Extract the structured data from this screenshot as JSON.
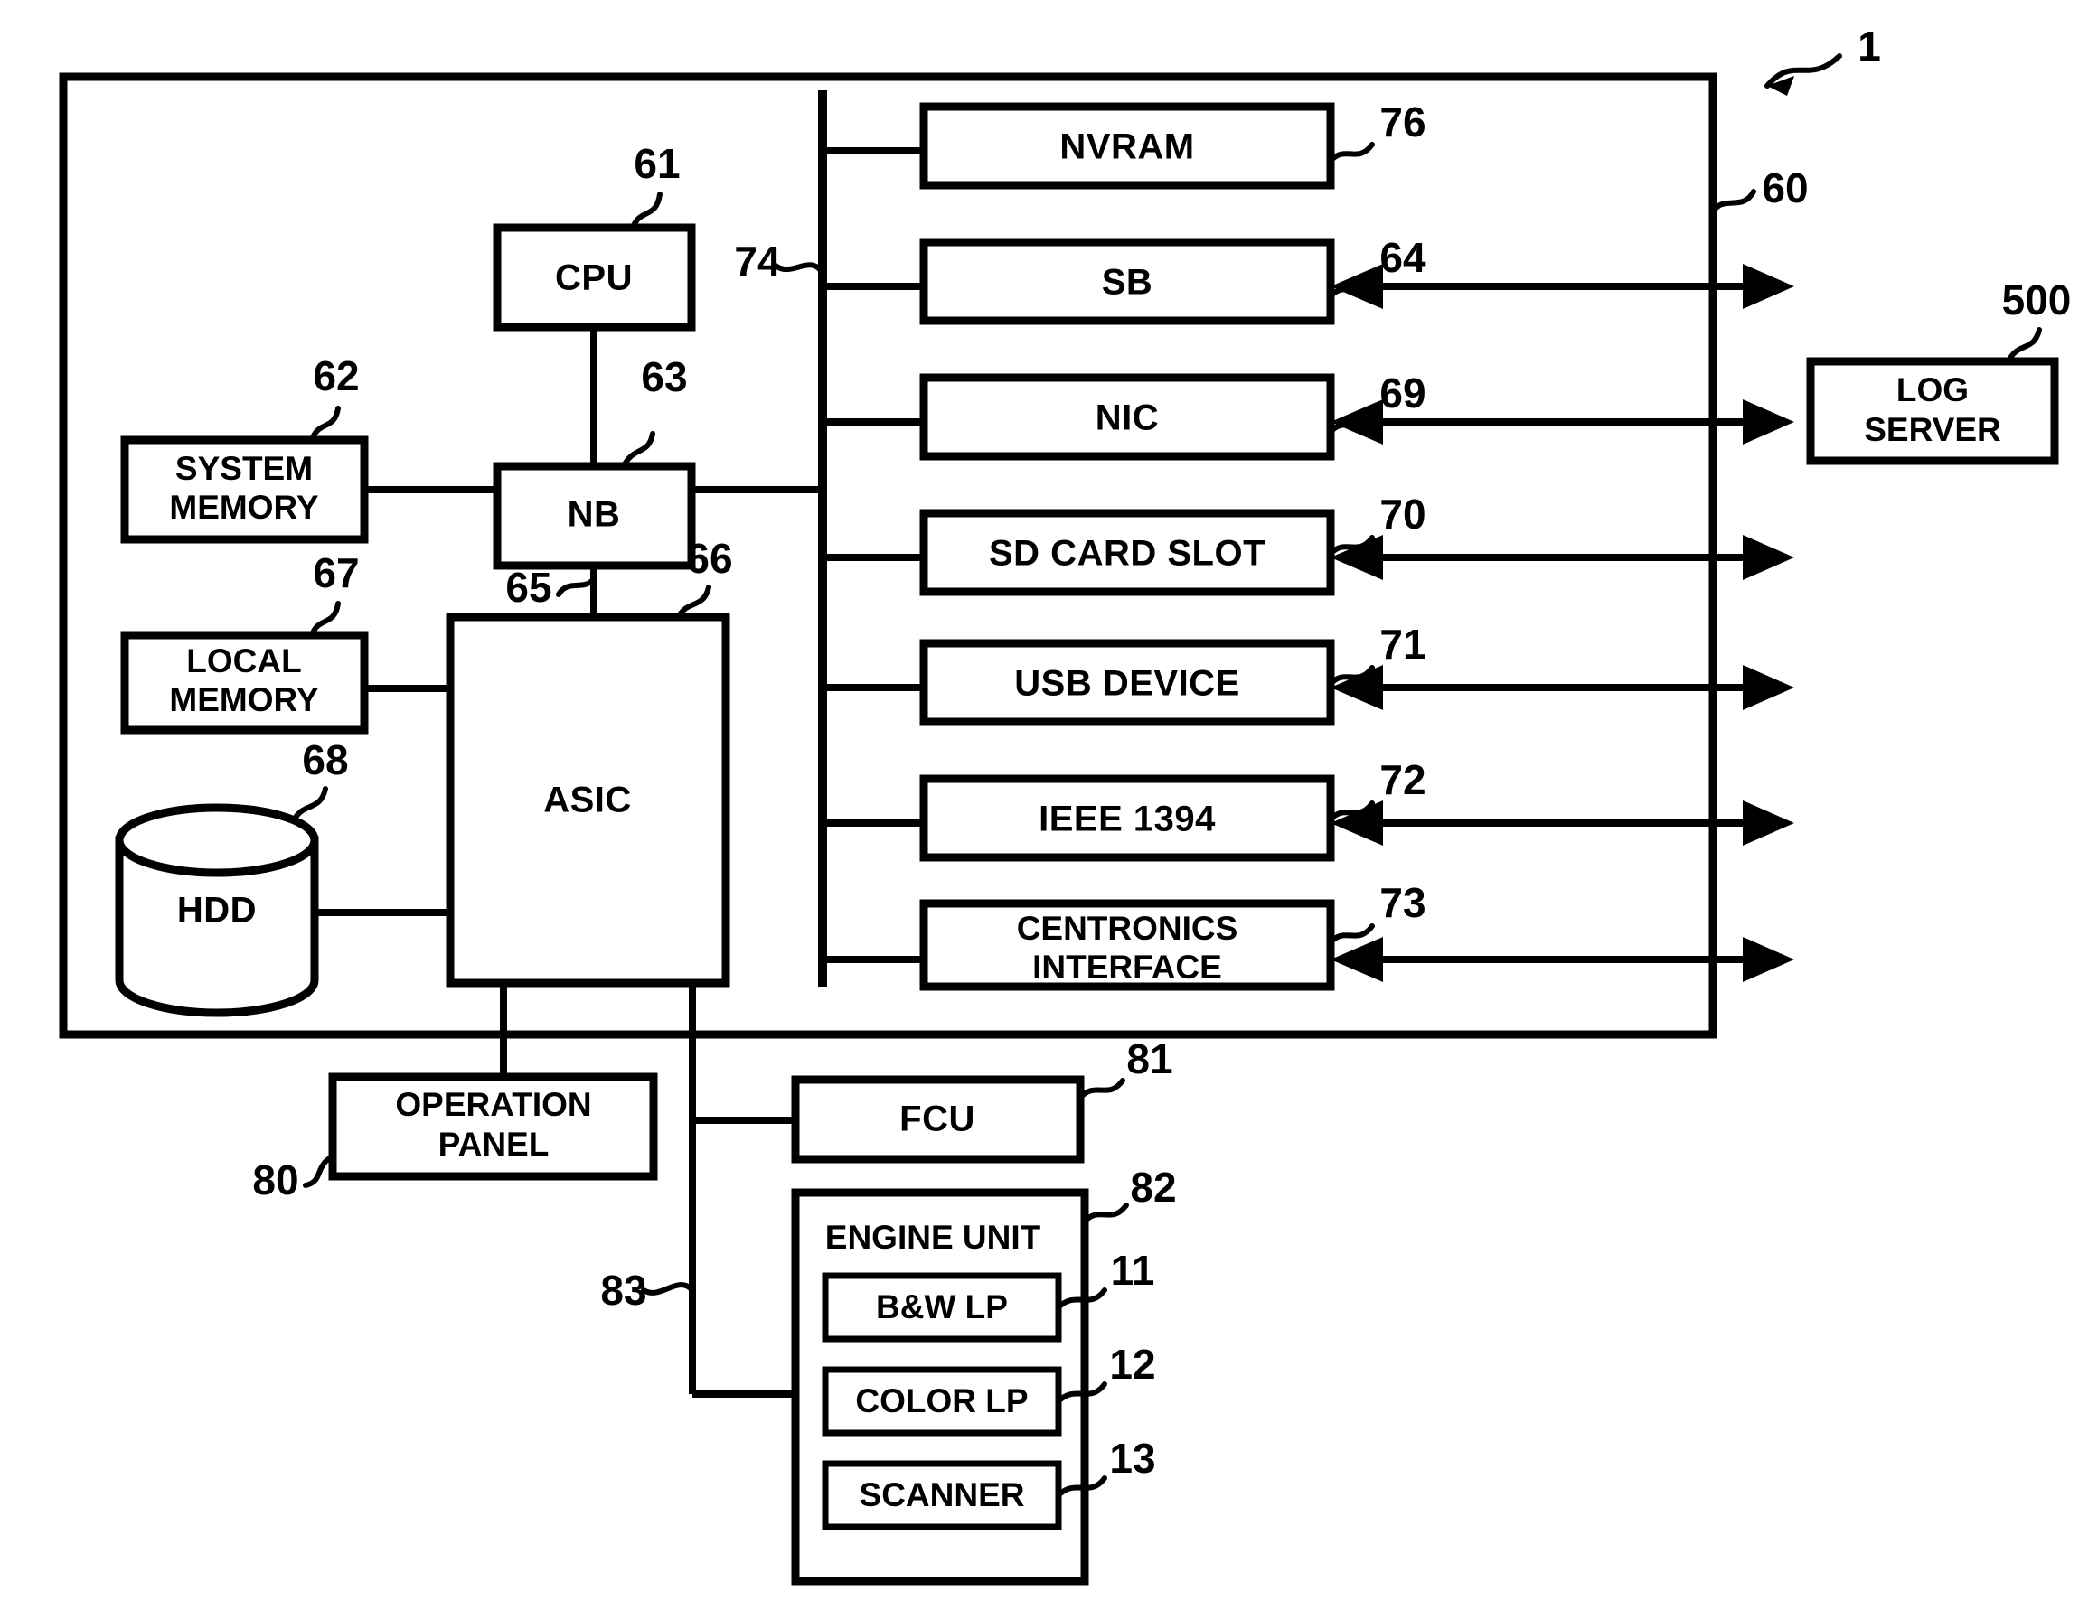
{
  "figure": {
    "type": "patent-block-diagram",
    "root_reference": "1",
    "background_color": "#ffffff",
    "line_color": "#000000"
  },
  "blocks": {
    "controller": {
      "label": "",
      "ref": "60"
    },
    "cpu": {
      "label": "CPU",
      "ref": "61"
    },
    "system_memory": {
      "label_line1": "SYSTEM",
      "label_line2": "MEMORY",
      "ref": "62"
    },
    "nb": {
      "label": "NB",
      "ref": "63"
    },
    "sb": {
      "label": "SB",
      "ref": "64"
    },
    "asic": {
      "label": "ASIC",
      "ref": "66"
    },
    "local_memory": {
      "label_line1": "LOCAL",
      "label_line2": "MEMORY",
      "ref": "67"
    },
    "hdd": {
      "label": "HDD",
      "ref": "68"
    },
    "nic": {
      "label": "NIC",
      "ref": "69"
    },
    "sd_card_slot": {
      "label": "SD CARD SLOT",
      "ref": "70"
    },
    "usb_device": {
      "label": "USB DEVICE",
      "ref": "71"
    },
    "ieee1394": {
      "label": "IEEE 1394",
      "ref": "72"
    },
    "centronics": {
      "label_line1": "CENTRONICS",
      "label_line2": "INTERFACE",
      "ref": "73"
    },
    "nvram": {
      "label": "NVRAM",
      "ref": "76"
    },
    "operation_panel": {
      "label_line1": "OPERATION",
      "label_line2": "PANEL",
      "ref": "80"
    },
    "fcu": {
      "label": "FCU",
      "ref": "81"
    },
    "engine_unit": {
      "label": "ENGINE UNIT",
      "ref": "82"
    },
    "bw_lp": {
      "label": "B&W LP",
      "ref": "11"
    },
    "color_lp": {
      "label": "COLOR LP",
      "ref": "12"
    },
    "scanner": {
      "label": "SCANNER",
      "ref": "13"
    },
    "log_server": {
      "label_line1": "LOG",
      "label_line2": "SERVER",
      "ref": "500"
    }
  },
  "buses": {
    "pci_bus": {
      "ref": "74"
    },
    "agp_bus": {
      "ref": "65"
    },
    "engine_bus": {
      "ref": "83"
    }
  },
  "reference_numerals": [
    "1",
    "11",
    "12",
    "13",
    "60",
    "61",
    "62",
    "63",
    "64",
    "65",
    "66",
    "67",
    "68",
    "69",
    "70",
    "71",
    "72",
    "73",
    "74",
    "76",
    "80",
    "81",
    "82",
    "83",
    "500"
  ]
}
